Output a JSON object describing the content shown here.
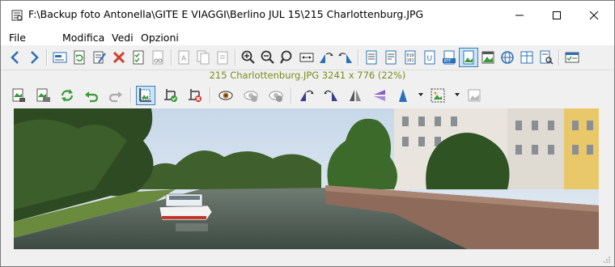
{
  "window": {
    "title": "F:\\Backup foto Antonella\\GITE E VIAGGI\\Berlino JUL 15\\215 Charlottenburg.JPG",
    "minimize_icon": "minimize-icon",
    "maximize_icon": "maximize-icon",
    "close_icon": "close-icon"
  },
  "menu": {
    "file": "File",
    "modifica": "Modifica",
    "vedi": "Vedi",
    "opzioni": "Opzioni"
  },
  "toolbar1": {
    "icons": [
      "back-icon",
      "forward-icon",
      "select-file-icon",
      "refresh-icon",
      "edit-icon",
      "delete-icon",
      "checklist-icon",
      "cut-icon",
      "text-icon",
      "copy-text-icon",
      "paste-icon",
      "zoom-in-icon",
      "zoom-out-icon",
      "zoom-icon",
      "fit-width-icon",
      "rotate-left-icon",
      "rotate-right-icon",
      "text-view-icon",
      "document-view-icon",
      "hex-view-icon",
      "unicode-view-icon",
      "rtf-view-icon",
      "image-view-icon",
      "multimedia-view-icon",
      "web-view-icon",
      "office-view-icon",
      "search-file-icon",
      "settings-icon"
    ]
  },
  "info": {
    "text": "215 Charlottenburg.JPG   3241 x 776 (22%)"
  },
  "toolbar2": {
    "icons": [
      "save-image-icon",
      "print-image-icon",
      "reload-icon",
      "undo-icon",
      "redo-icon",
      "crop-icon",
      "crop-apply-icon",
      "crop-cancel-icon",
      "preview-icon",
      "hide-icon",
      "hide-all-icon",
      "flip-left-icon",
      "flip-right-icon",
      "mirror-icon",
      "flip-vertical-icon",
      "triangle-icon",
      "selection-icon",
      "background-image-icon"
    ]
  },
  "colors": {
    "accent": "#2a6fb8",
    "info_text": "#7a8c1c",
    "delete": "#d23b2a",
    "green": "#3a9a3a"
  }
}
